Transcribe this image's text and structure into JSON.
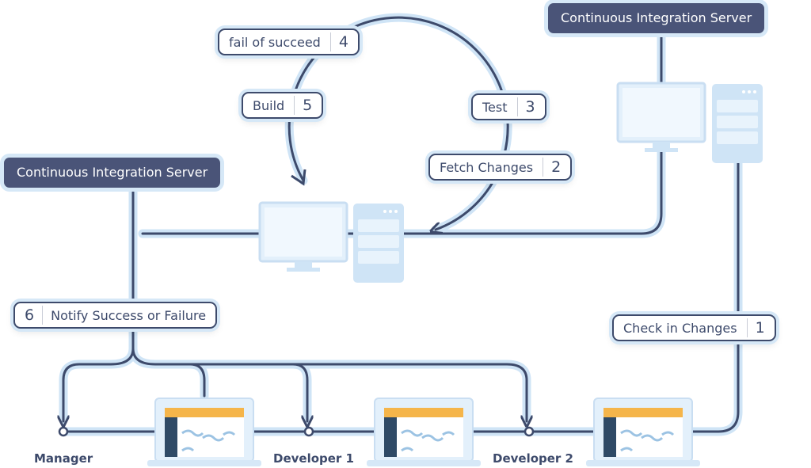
{
  "servers": [
    {
      "label": "Continuous Integration Server"
    },
    {
      "label": "Continuous Integration Server"
    }
  ],
  "steps": [
    {
      "number": "1",
      "label": "Check in Changes"
    },
    {
      "number": "2",
      "label": "Fetch Changes"
    },
    {
      "number": "3",
      "label": "Test"
    },
    {
      "number": "4",
      "label": "fail of succeed"
    },
    {
      "number": "5",
      "label": "Build"
    },
    {
      "number": "6",
      "label": "Notify Success or Failure"
    }
  ],
  "people": [
    {
      "label": "Manager"
    },
    {
      "label": "Developer 1"
    },
    {
      "label": "Developer 2"
    }
  ],
  "colors": {
    "line": "#3d4a6b",
    "halo": "#cfe4f6",
    "device": "#e3f0fb",
    "screen_header": "#f5b54a",
    "laptop_sidebar": "#2f4a66",
    "server_box": "#4a5478"
  }
}
